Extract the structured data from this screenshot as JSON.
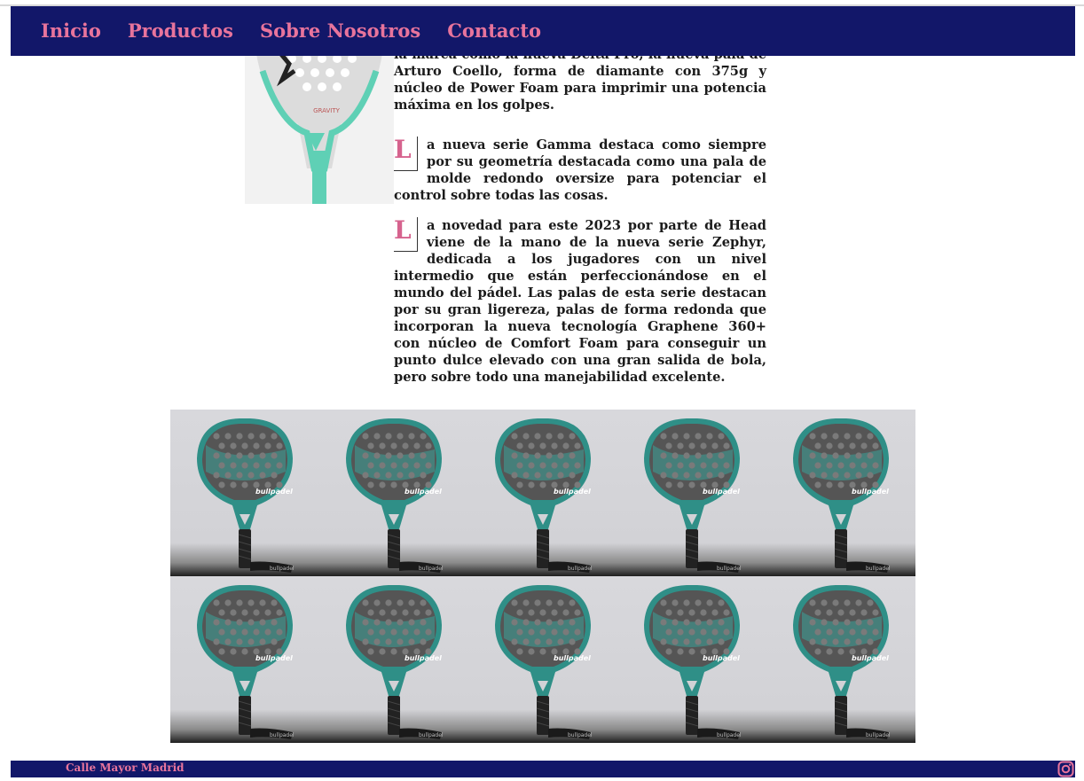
{
  "nav": {
    "links": [
      "Inicio",
      "Productos",
      "Sobre Nosotros",
      "Contacto"
    ]
  },
  "article": {
    "p1_text": "la marca como la nueva Delta Pro, la nueva pala de Arturo Coello, forma de diamante con 375g y núcleo de Power Foam para imprimir una potencia máxima en los golpes.",
    "p2_dropcap": "L",
    "p2_text": "a nueva serie Gamma destaca como siempre por su geometría destacada como una pala de molde redondo oversize para potenciar el control sobre todas las cosas.",
    "p3_dropcap": "L",
    "p3_text": "a novedad para este 2023 por parte de Head viene de la mano de la nueva serie Zephyr, dedicada a los jugadores con un nivel intermedio que están perfeccionándose en el mundo del pádel. Las palas de esta serie destacan por su gran ligereza, palas de forma redonda que incorporan la nueva tecnología Graphene 360+ con núcleo de Comfort Foam para conseguir un punto dulce elevado con una gran salida de bola, pero sobre todo una manejabilidad excelente.",
    "racket_photo_text": "GRAVITY"
  },
  "gallery": {
    "brand_text": "bullpadel",
    "count": 10
  },
  "footer": {
    "address": "Calle Mayor Madrid",
    "social_icon": "instagram-icon"
  },
  "colors": {
    "nav_bg": "#121769",
    "accent": "#e8749c"
  }
}
